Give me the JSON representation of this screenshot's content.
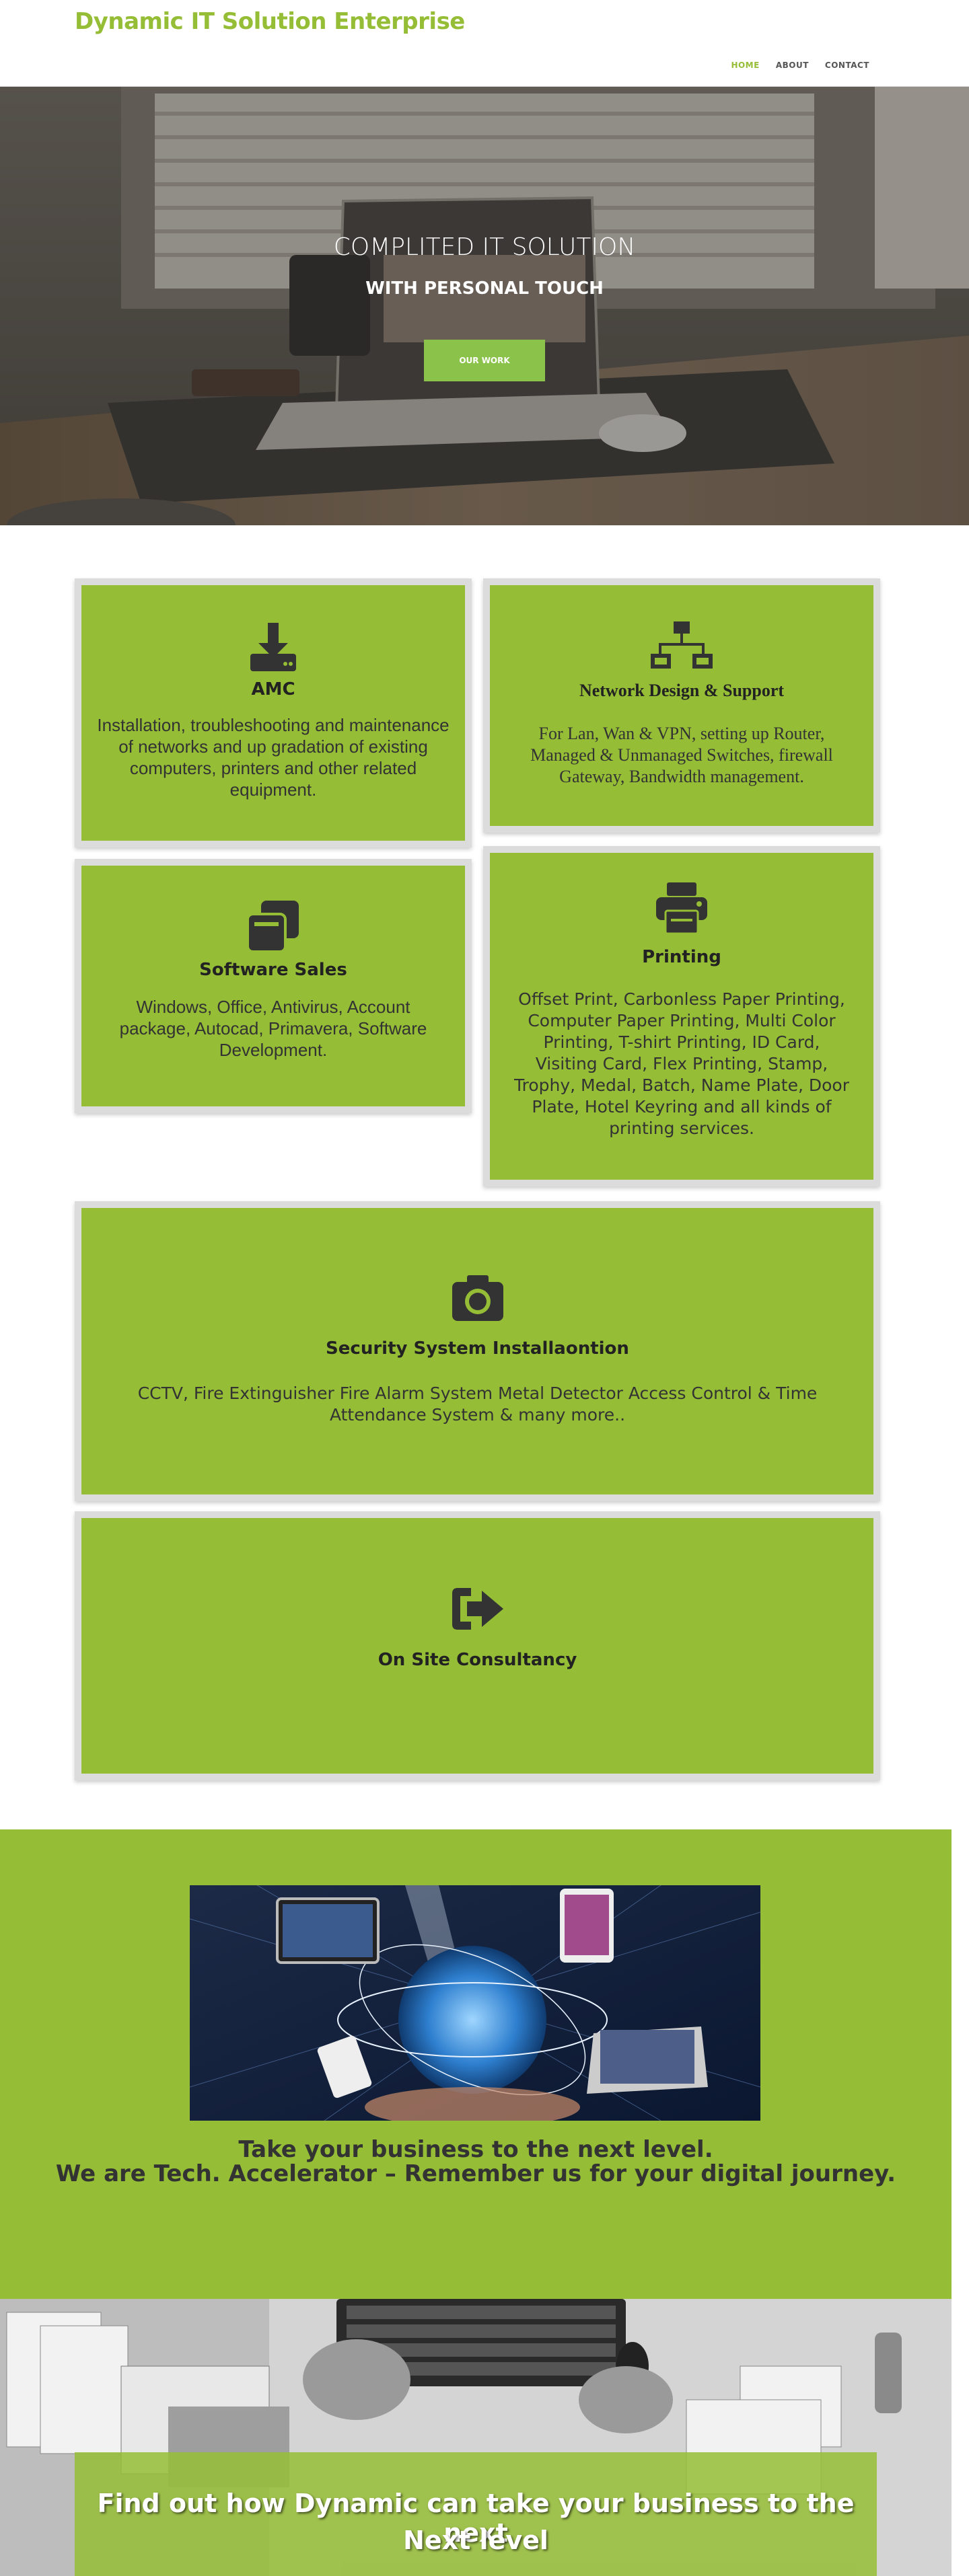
{
  "header": {
    "brand": "Dynamic IT Solution Enterprise",
    "nav": [
      "HOME",
      "ABOUT",
      "CONTACT"
    ]
  },
  "hero": {
    "title": "COMPLITED IT SOLUTION",
    "subtitle": "WITH PERSONAL TOUCH",
    "button": "OUR WORK"
  },
  "services": {
    "amc": {
      "title": "AMC",
      "text": "Installation, troubleshooting and maintenance of networks and up gradation of existing computers, printers and other related equipment."
    },
    "network": {
      "title": "Network Design & Support",
      "text": "For Lan, Wan & VPN, setting up Router, Managed & Unmanaged Switches, firewall Gateway, Bandwidth management."
    },
    "software": {
      "title": "Software Sales",
      "text": "Windows, Office, Antivirus, Account package, Autocad, Primavera, Software Development."
    },
    "printing": {
      "title": "Printing",
      "text": "Offset Print, Carbonless Paper Printing, Computer Paper Printing, Multi Color Printing, T-shirt Printing, ID Card, Visiting Card, Flex Printing, Stamp, Trophy, Medal, Batch, Name Plate, Door Plate, Hotel Keyring and all kinds of printing services."
    },
    "security": {
      "title": "Security System Installaontion",
      "text": "CCTV, Fire Extinguisher Fire Alarm System Metal Detector Access Control & Time Attendance System & many more.."
    },
    "consult": {
      "title": "On Site Consultancy"
    }
  },
  "band": {
    "line1": "Take your business to the next level.",
    "line2": "We are Tech. Accelerator – Remember us for your digital journey."
  },
  "cta": {
    "line1": "Find out how Dynamic can take your business to the next",
    "line2": "Next level"
  },
  "colors": {
    "accent": "#95bd35",
    "button": "#8bc34a",
    "card_border": "#dcdcdc"
  },
  "icons": [
    "download-icon",
    "sitemap-icon",
    "clone-icon",
    "print-icon",
    "camera-icon",
    "sign-out-icon"
  ]
}
